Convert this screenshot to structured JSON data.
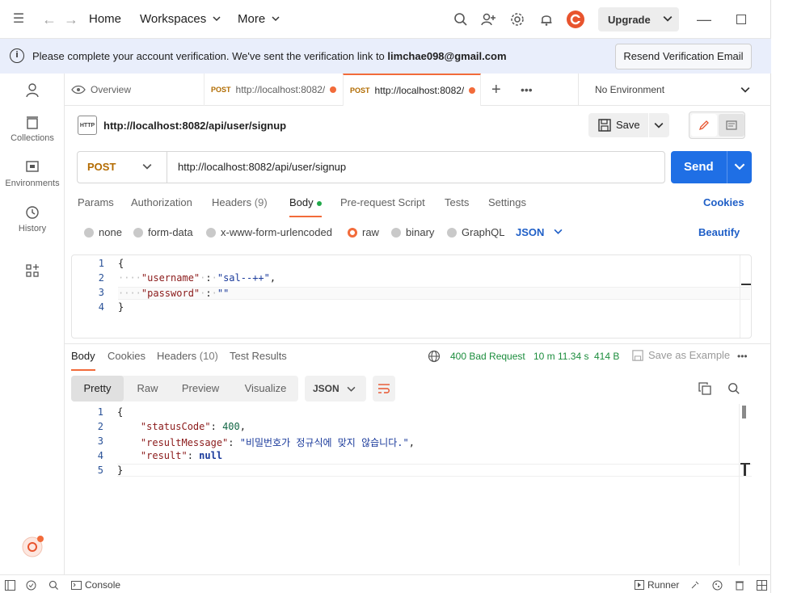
{
  "header": {
    "home": "Home",
    "workspaces": "Workspaces",
    "more": "More",
    "upgrade": "Upgrade"
  },
  "banner": {
    "message_prefix": "Please complete your account verification. We've sent the verification link to",
    "email": "limchae098@gmail.com",
    "resend_label": "Resend Verification Email"
  },
  "sidebar": {
    "items": [
      {
        "label": ""
      },
      {
        "label": "Collections"
      },
      {
        "label": "Environments"
      },
      {
        "label": "History"
      },
      {
        "label": ""
      }
    ]
  },
  "tabs": {
    "overview": "Overview",
    "items": [
      {
        "method": "POST",
        "label": "http://localhost:8082/"
      },
      {
        "method": "POST",
        "label": "http://localhost:8082/"
      }
    ],
    "environment": "No Environment"
  },
  "request": {
    "title": "http://localhost:8082/api/user/signup",
    "save_label": "Save",
    "method": "POST",
    "url": "http://localhost:8082/api/user/signup",
    "send_label": "Send",
    "tabs": [
      "Params",
      "Authorization",
      "Headers",
      "Body",
      "Pre-request Script",
      "Tests",
      "Settings"
    ],
    "headers_count": "(9)",
    "cookies_label": "Cookies",
    "body_types": [
      "none",
      "form-data",
      "x-www-form-urlencoded",
      "raw",
      "binary",
      "GraphQL"
    ],
    "body_format": "JSON",
    "beautify_label": "Beautify",
    "body_lines": {
      "l1": "{",
      "l2_key": "\"username\"",
      "l2_val": "\"sal--++\"",
      "l3_key": "\"password\"",
      "l3_val": "\"\"",
      "l4": "}"
    }
  },
  "response": {
    "tabs": [
      "Body",
      "Cookies",
      "Headers",
      "Test Results"
    ],
    "headers_count": "(10)",
    "status": "400 Bad Request",
    "time": "10 m 11.34 s",
    "size": "414 B",
    "save_example": "Save as Example",
    "views": [
      "Pretty",
      "Raw",
      "Preview",
      "Visualize"
    ],
    "format": "JSON",
    "lines": {
      "k1": "\"statusCode\"",
      "v1": "400",
      "k2": "\"resultMessage\"",
      "v2": "\"비밀번호가 정규식에 맞지 않습니다.\"",
      "k3": "\"result\"",
      "v3": "null"
    }
  },
  "statusbar": {
    "console": "Console",
    "runner": "Runner"
  },
  "colors": {
    "accent": "#f26b3a",
    "send": "#1f6fe5",
    "link": "#1f5fc7",
    "status_error": "#1c8d3d",
    "banner_bg": "#e9eefb"
  }
}
